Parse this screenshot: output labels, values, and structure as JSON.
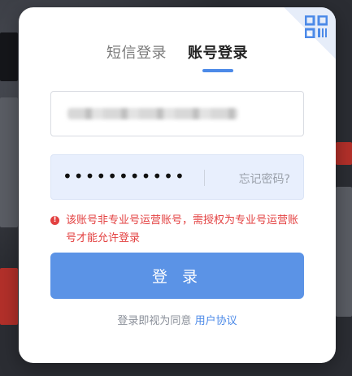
{
  "tabs": [
    {
      "label": "短信登录",
      "active": false
    },
    {
      "label": "账号登录",
      "active": true
    }
  ],
  "account": {
    "value": ""
  },
  "password": {
    "masked": "•••••••••••",
    "forgot_label": "忘记密码?"
  },
  "error": {
    "message": "该账号非专业号运营账号，需授权为专业号运营账号才能允许登录"
  },
  "login_button": {
    "label": "登 录"
  },
  "agreement": {
    "prefix": "登录即视为同意",
    "link_label": "用户协议"
  },
  "colors": {
    "accent": "#4c8ae8",
    "error": "#e34040",
    "button": "#5b93e6"
  },
  "icons": {
    "corner": "qr-code-icon",
    "error": "exclamation-circle-icon"
  }
}
